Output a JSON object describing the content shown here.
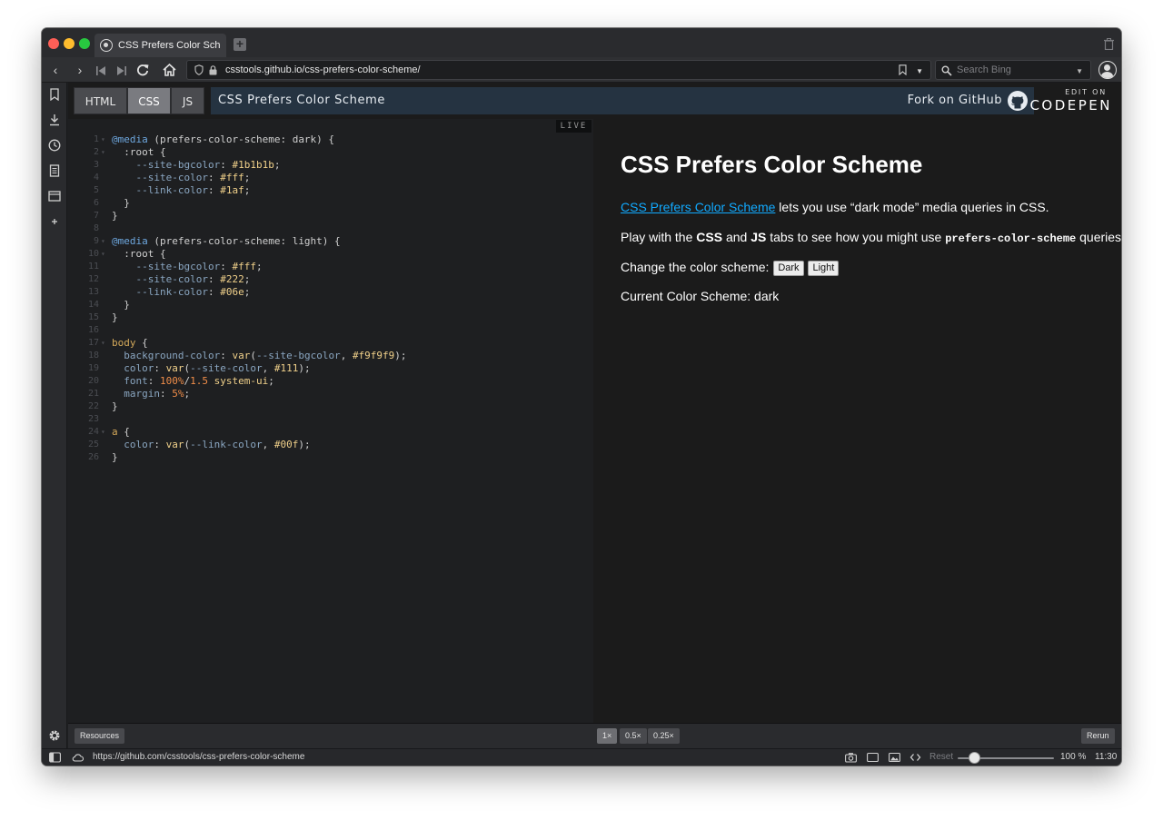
{
  "browser": {
    "tab_title": "CSS Prefers Color Scheme",
    "url": "csstools.github.io/css-prefers-color-scheme/",
    "search_placeholder": "Search Bing"
  },
  "codepen": {
    "tabs": [
      {
        "label": "HTML",
        "active": false
      },
      {
        "label": "CSS",
        "active": true
      },
      {
        "label": "JS",
        "active": false
      }
    ],
    "title": "CSS Prefers Color Scheme",
    "fork_label": "Fork on GitHub",
    "edit_on_label": "EDIT ON",
    "logo_text": "CODEPEN",
    "live_label": "LIVE"
  },
  "editor": {
    "lines": [
      {
        "n": "1",
        "fold": true,
        "tokens": [
          [
            "at",
            "@media"
          ],
          [
            "p",
            " (prefers-color-scheme: dark) {"
          ]
        ]
      },
      {
        "n": "2",
        "fold": true,
        "tokens": [
          [
            "p",
            "  :root {"
          ]
        ]
      },
      {
        "n": "3",
        "fold": false,
        "tokens": [
          [
            "prop",
            "    --site-bgcolor"
          ],
          [
            "p",
            ": "
          ],
          [
            "val",
            "#1b1b1b"
          ],
          [
            "p",
            ";"
          ]
        ]
      },
      {
        "n": "4",
        "fold": false,
        "tokens": [
          [
            "prop",
            "    --site-color"
          ],
          [
            "p",
            ": "
          ],
          [
            "val",
            "#fff"
          ],
          [
            "p",
            ";"
          ]
        ]
      },
      {
        "n": "5",
        "fold": false,
        "tokens": [
          [
            "prop",
            "    --link-color"
          ],
          [
            "p",
            ": "
          ],
          [
            "val",
            "#1af"
          ],
          [
            "p",
            ";"
          ]
        ]
      },
      {
        "n": "6",
        "fold": false,
        "tokens": [
          [
            "p",
            "  }"
          ]
        ]
      },
      {
        "n": "7",
        "fold": false,
        "tokens": [
          [
            "p",
            "}"
          ]
        ]
      },
      {
        "n": "8",
        "fold": false,
        "tokens": [
          [
            "p",
            ""
          ]
        ]
      },
      {
        "n": "9",
        "fold": true,
        "tokens": [
          [
            "at",
            "@media"
          ],
          [
            "p",
            " (prefers-color-scheme: light) {"
          ]
        ]
      },
      {
        "n": "10",
        "fold": true,
        "tokens": [
          [
            "p",
            "  :root {"
          ]
        ]
      },
      {
        "n": "11",
        "fold": false,
        "tokens": [
          [
            "prop",
            "    --site-bgcolor"
          ],
          [
            "p",
            ": "
          ],
          [
            "val",
            "#fff"
          ],
          [
            "p",
            ";"
          ]
        ]
      },
      {
        "n": "12",
        "fold": false,
        "tokens": [
          [
            "prop",
            "    --site-color"
          ],
          [
            "p",
            ": "
          ],
          [
            "val",
            "#222"
          ],
          [
            "p",
            ";"
          ]
        ]
      },
      {
        "n": "13",
        "fold": false,
        "tokens": [
          [
            "prop",
            "    --link-color"
          ],
          [
            "p",
            ": "
          ],
          [
            "val",
            "#06e"
          ],
          [
            "p",
            ";"
          ]
        ]
      },
      {
        "n": "14",
        "fold": false,
        "tokens": [
          [
            "p",
            "  }"
          ]
        ]
      },
      {
        "n": "15",
        "fold": false,
        "tokens": [
          [
            "p",
            "}"
          ]
        ]
      },
      {
        "n": "16",
        "fold": false,
        "tokens": [
          [
            "p",
            ""
          ]
        ]
      },
      {
        "n": "17",
        "fold": true,
        "tokens": [
          [
            "sel",
            "body"
          ],
          [
            "p",
            " {"
          ]
        ]
      },
      {
        "n": "18",
        "fold": false,
        "tokens": [
          [
            "prop",
            "  background-color"
          ],
          [
            "p",
            ": "
          ],
          [
            "fn",
            "var"
          ],
          [
            "p",
            "("
          ],
          [
            "prop",
            "--site-bgcolor"
          ],
          [
            "p",
            ", "
          ],
          [
            "val",
            "#f9f9f9"
          ],
          [
            "p",
            ");"
          ]
        ]
      },
      {
        "n": "19",
        "fold": false,
        "tokens": [
          [
            "prop",
            "  color"
          ],
          [
            "p",
            ": "
          ],
          [
            "fn",
            "var"
          ],
          [
            "p",
            "("
          ],
          [
            "prop",
            "--site-color"
          ],
          [
            "p",
            ", "
          ],
          [
            "val",
            "#111"
          ],
          [
            "p",
            ");"
          ]
        ]
      },
      {
        "n": "20",
        "fold": false,
        "tokens": [
          [
            "prop",
            "  font"
          ],
          [
            "p",
            ": "
          ],
          [
            "num",
            "100%"
          ],
          [
            "p",
            "/"
          ],
          [
            "num",
            "1.5"
          ],
          [
            "p",
            " "
          ],
          [
            "val",
            "system-ui"
          ],
          [
            "p",
            ";"
          ]
        ]
      },
      {
        "n": "21",
        "fold": false,
        "tokens": [
          [
            "prop",
            "  margin"
          ],
          [
            "p",
            ": "
          ],
          [
            "num",
            "5%"
          ],
          [
            "p",
            ";"
          ]
        ]
      },
      {
        "n": "22",
        "fold": false,
        "tokens": [
          [
            "p",
            "}"
          ]
        ]
      },
      {
        "n": "23",
        "fold": false,
        "tokens": [
          [
            "p",
            ""
          ]
        ]
      },
      {
        "n": "24",
        "fold": true,
        "tokens": [
          [
            "sel",
            "a"
          ],
          [
            "p",
            " {"
          ]
        ]
      },
      {
        "n": "25",
        "fold": false,
        "tokens": [
          [
            "prop",
            "  color"
          ],
          [
            "p",
            ": "
          ],
          [
            "fn",
            "var"
          ],
          [
            "p",
            "("
          ],
          [
            "prop",
            "--link-color"
          ],
          [
            "p",
            ", "
          ],
          [
            "val",
            "#00f"
          ],
          [
            "p",
            ");"
          ]
        ]
      },
      {
        "n": "26",
        "fold": false,
        "tokens": [
          [
            "p",
            "}"
          ]
        ]
      }
    ],
    "token_colors": {
      "at": "#6ea8e0",
      "p": "#d0d0d0",
      "prop": "#8aa6c1",
      "val": "#f0d08a",
      "sel": "#d4a95a",
      "fn": "#f0d08a",
      "num": "#f08d49"
    }
  },
  "preview": {
    "heading": "CSS Prefers Color Scheme",
    "p1_link": "CSS Prefers Color Scheme",
    "p1_rest": " lets you use “dark mode” media queries in CSS.",
    "p2_a": "Play with the ",
    "p2_css": "CSS",
    "p2_b": " and ",
    "p2_js": "JS",
    "p2_c": " tabs to see how you might use ",
    "p2_code": "prefers-color-scheme",
    "p2_d": " queries.",
    "p3_label": "Change the color scheme:",
    "btn_dark": "Dark",
    "btn_light": "Light",
    "p4": "Current Color Scheme: dark"
  },
  "footer": {
    "resources_label": "Resources",
    "zoom_options": [
      {
        "label": "1×",
        "active": true
      },
      {
        "label": "0.5×",
        "active": false
      },
      {
        "label": "0.25×",
        "active": false
      }
    ],
    "rerun_label": "Rerun"
  },
  "statusbar": {
    "link_url": "https://github.com/csstools/css-prefers-color-scheme",
    "reset_label": "Reset",
    "zoom_percent": "100 %",
    "zoom_value": 100,
    "clock": "11:30"
  }
}
